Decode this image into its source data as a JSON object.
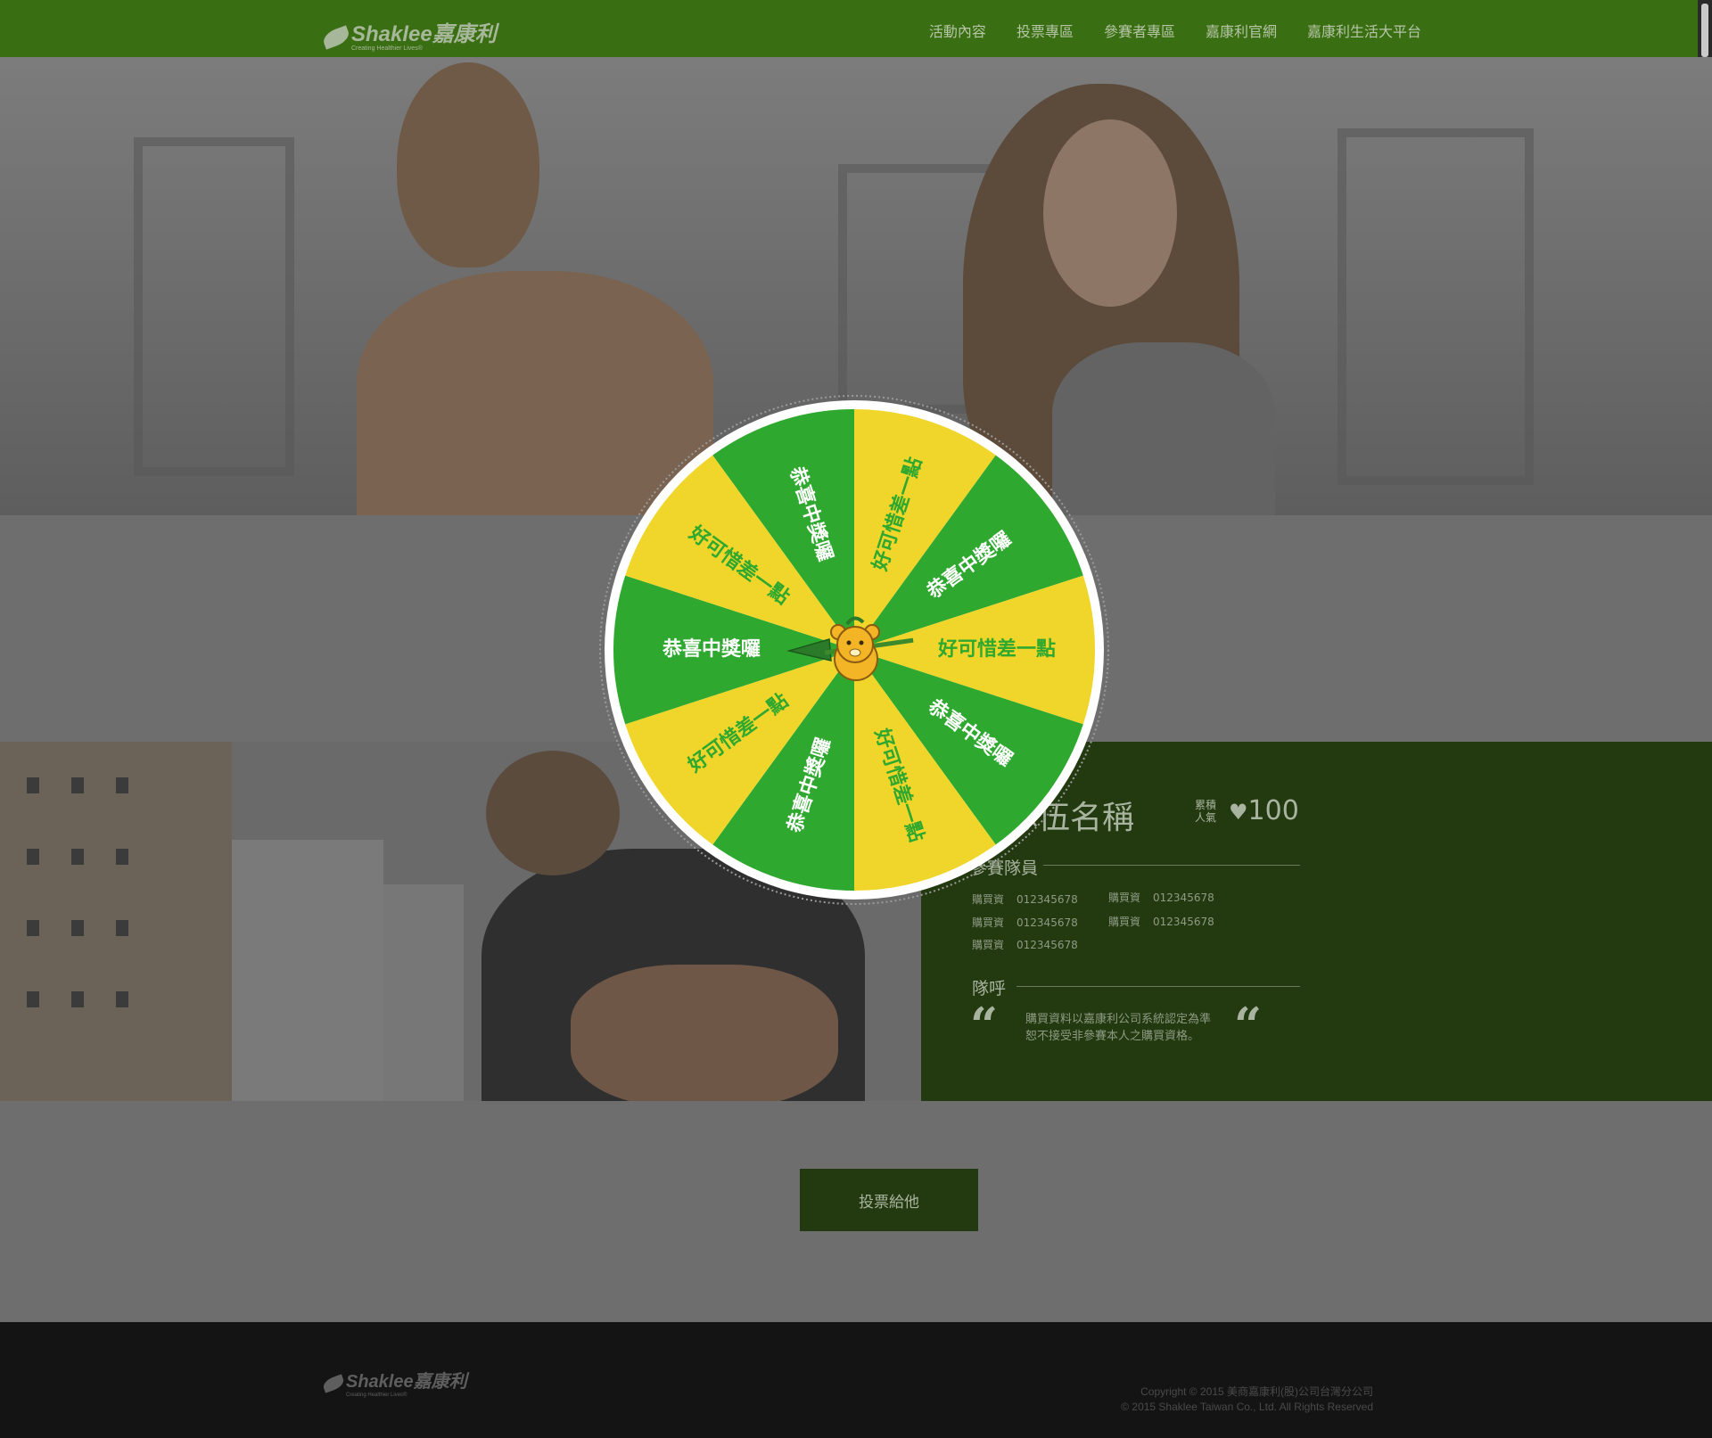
{
  "header": {
    "logo_word": "Shaklee嘉康利",
    "logo_tagline": "Creating Healthier Lives®",
    "nav": [
      "活動內容",
      "投票專區",
      "參賽者專區",
      "嘉康利官網",
      "嘉康利生活大平台"
    ]
  },
  "wheel": {
    "segments": [
      {
        "label": "好可惜差一點",
        "color": "#f0d62a",
        "text_color": "#2ea82e"
      },
      {
        "label": "恭喜中獎囉",
        "color": "#2ea82e",
        "text_color": "#ffffff"
      },
      {
        "label": "好可惜差一點",
        "color": "#f0d62a",
        "text_color": "#2ea82e"
      },
      {
        "label": "恭喜中獎囉",
        "color": "#2ea82e",
        "text_color": "#ffffff"
      },
      {
        "label": "好可惜差一點",
        "color": "#f0d62a",
        "text_color": "#2ea82e"
      },
      {
        "label": "恭喜中獎囉",
        "color": "#2ea82e",
        "text_color": "#ffffff"
      },
      {
        "label": "好可惜差一點",
        "color": "#f0d62a",
        "text_color": "#2ea82e"
      },
      {
        "label": "恭喜中獎囉",
        "color": "#2ea82e",
        "text_color": "#ffffff"
      },
      {
        "label": "好可惜差一點",
        "color": "#f0d62a",
        "text_color": "#2ea82e"
      },
      {
        "label": "恭喜中獎囉",
        "color": "#2ea82e",
        "text_color": "#ffffff"
      }
    ],
    "pointer_icon": "bear-arrow-icon"
  },
  "team": {
    "name": "隊伍名稱",
    "popularity_label": [
      "累積",
      "人氣"
    ],
    "popularity_value": "100",
    "members_title": "參賽隊員",
    "members": [
      {
        "label": "購買資",
        "value": "012345678"
      },
      {
        "label": "購買資",
        "value": "012345678"
      },
      {
        "label": "購買資",
        "value": "012345678"
      },
      {
        "label": "購買資",
        "value": "012345678"
      },
      {
        "label": "購買資",
        "value": "012345678"
      }
    ],
    "slogan_title": "隊呼",
    "slogan_lines": [
      "購買資料以嘉康利公司系統認定為準",
      "恕不接受非參賽本人之購買資格。"
    ]
  },
  "vote_button": "投票給他",
  "footer": {
    "copyright_1": "Copyright © 2015 美商嘉康利(股)公司台灣分公司",
    "copyright_2": "© 2015 Shaklee Taiwan Co., Ltd. All Rights Reserved"
  }
}
